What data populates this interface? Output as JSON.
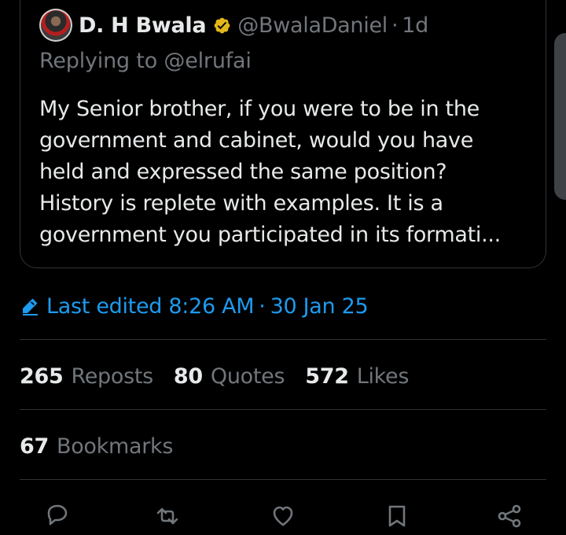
{
  "quote": {
    "author_name": "D. H Bwala",
    "handle": "@BwalaDaniel",
    "separator": "·",
    "age": "1d",
    "replying_to": "Replying to @elrufai",
    "text_lines": [
      "My Senior brother,  if you were to be in the",
      "government and cabinet, would you have",
      "held and expressed the same position?",
      "History is replete with examples. It is a",
      "government you participated in its formati..."
    ]
  },
  "edited": {
    "label": "Last edited 8:26 AM",
    "separator": "·",
    "date": "30 Jan 25"
  },
  "stats": {
    "reposts": {
      "count": "265",
      "label": "Reposts"
    },
    "quotes": {
      "count": "80",
      "label": "Quotes"
    },
    "likes": {
      "count": "572",
      "label": "Likes"
    },
    "bookmarks": {
      "count": "67",
      "label": "Bookmarks"
    }
  },
  "icons": {
    "verified": "verified-badge-icon",
    "edit": "pencil-icon",
    "reply": "reply-icon",
    "repost": "repost-icon",
    "like": "heart-icon",
    "bookmark": "bookmark-icon",
    "share": "share-icon"
  },
  "colors": {
    "background": "#000000",
    "text": "#e7e9ea",
    "secondary": "#71767b",
    "accent": "#1d9bf0",
    "verified_gold": "#e2b719",
    "border": "#2f3336"
  }
}
